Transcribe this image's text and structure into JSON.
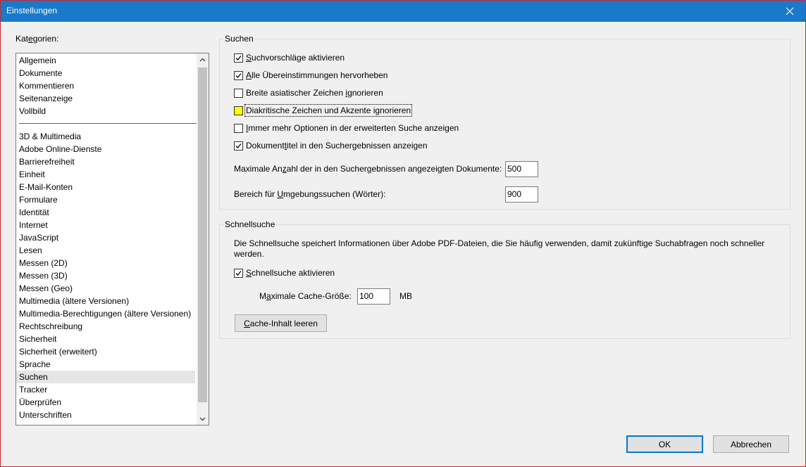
{
  "window": {
    "title": "Einstellungen"
  },
  "categories": {
    "label": "Kategorien:",
    "top_items": [
      "Allgemein",
      "Dokumente",
      "Kommentieren",
      "Seitenanzeige",
      "Vollbild"
    ],
    "items": [
      "3D & Multimedia",
      "Adobe Online-Dienste",
      "Barrierefreiheit",
      "Einheit",
      "E-Mail-Konten",
      "Formulare",
      "Identität",
      "Internet",
      "JavaScript",
      "Lesen",
      "Messen (2D)",
      "Messen (3D)",
      "Messen (Geo)",
      "Multimedia (ältere Versionen)",
      "Multimedia-Berechtigungen (ältere Versionen)",
      "Rechtschreibung",
      "Sicherheit",
      "Sicherheit (erweitert)",
      "Sprache",
      "Suchen",
      "Tracker",
      "Überprüfen",
      "Unterschriften"
    ],
    "selected": "Suchen"
  },
  "search": {
    "group_title": "Suchen",
    "checkboxes": [
      {
        "label": "Suchvorschläge aktivieren",
        "checked": true
      },
      {
        "label": "Alle Übereinstimmungen hervorheben",
        "checked": true
      },
      {
        "label": "Breite asiatischer Zeichen ignorieren",
        "checked": false
      },
      {
        "label": "Diakritische Zeichen und Akzente ignorieren",
        "checked": false
      },
      {
        "label": "Immer mehr Optionen in der erweiterten Suche anzeigen",
        "checked": false
      },
      {
        "label": "Dokumenttitel in den Suchergebnissen anzeigen",
        "checked": true
      }
    ],
    "max_docs_label": "Maximale Anzahl der in den Suchergebnissen angezeigten Dokumente:",
    "max_docs_value": "500",
    "range_label": "Bereich für Umgebungssuchen (Wörter):",
    "range_value": "900"
  },
  "quicksearch": {
    "group_title": "Schnellsuche",
    "description": "Die Schnellsuche speichert Informationen über Adobe PDF-Dateien, die Sie häufig verwenden, damit zukünftige Suchabfragen noch schneller werden.",
    "enable_label": "Schnellsuche aktivieren",
    "enable_checked": true,
    "cache_label": "Maximale Cache-Größe:",
    "cache_value": "100",
    "cache_unit": "MB",
    "clear_button": "Cache-Inhalt leeren"
  },
  "buttons": {
    "ok": "OK",
    "cancel": "Abbrechen"
  },
  "colors": {
    "titlebar": "#1979ca",
    "highlight": "#ffff00",
    "selection": "#e5e5e5"
  },
  "icons": [
    "close-icon",
    "check-icon",
    "chevron-up-icon",
    "chevron-down-icon"
  ]
}
